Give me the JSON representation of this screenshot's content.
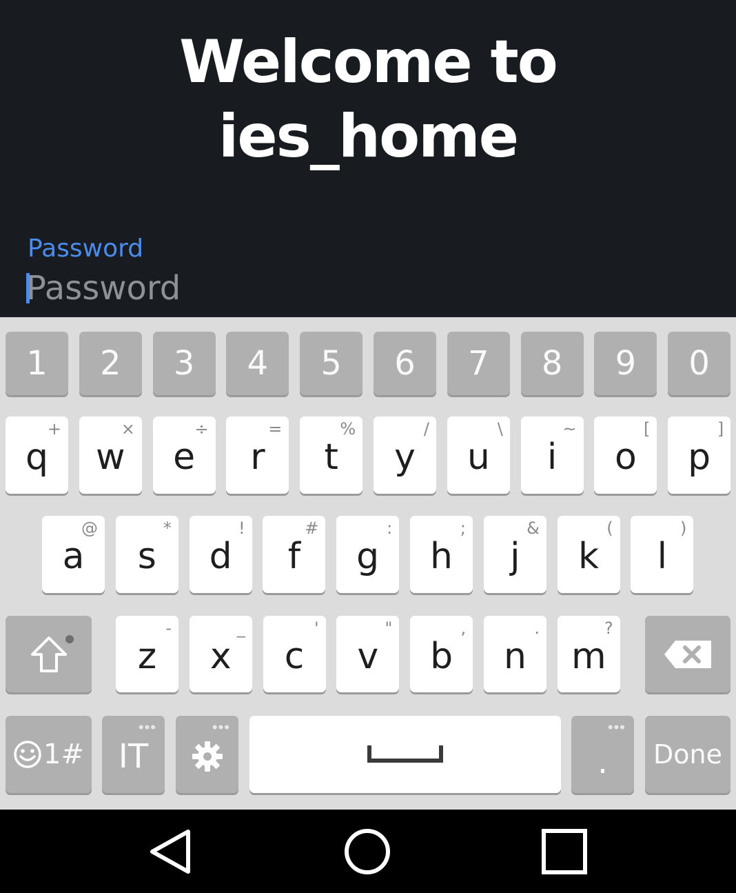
{
  "login": {
    "title_line1": "Welcome to",
    "title_line2": "ies_home",
    "password_label": "Password",
    "password_placeholder": "Password",
    "accent_color": "#4a8cf0"
  },
  "keyboard": {
    "numbers": [
      "1",
      "2",
      "3",
      "4",
      "5",
      "6",
      "7",
      "8",
      "9",
      "0"
    ],
    "row1": [
      {
        "key": "q",
        "alt": "+"
      },
      {
        "key": "w",
        "alt": "×"
      },
      {
        "key": "e",
        "alt": "÷"
      },
      {
        "key": "r",
        "alt": "="
      },
      {
        "key": "t",
        "alt": "%"
      },
      {
        "key": "y",
        "alt": "/"
      },
      {
        "key": "u",
        "alt": "\\"
      },
      {
        "key": "i",
        "alt": "~"
      },
      {
        "key": "o",
        "alt": "["
      },
      {
        "key": "p",
        "alt": "]"
      }
    ],
    "row2": [
      {
        "key": "a",
        "alt": "@"
      },
      {
        "key": "s",
        "alt": "*"
      },
      {
        "key": "d",
        "alt": "!"
      },
      {
        "key": "f",
        "alt": "#"
      },
      {
        "key": "g",
        "alt": ":"
      },
      {
        "key": "h",
        "alt": ";"
      },
      {
        "key": "j",
        "alt": "&"
      },
      {
        "key": "k",
        "alt": "("
      },
      {
        "key": "l",
        "alt": ")"
      }
    ],
    "row3": [
      {
        "key": "z",
        "alt": "-"
      },
      {
        "key": "x",
        "alt": "_"
      },
      {
        "key": "c",
        "alt": "'"
      },
      {
        "key": "v",
        "alt": "\""
      },
      {
        "key": "b",
        "alt": ","
      },
      {
        "key": "n",
        "alt": "."
      },
      {
        "key": "m",
        "alt": "?"
      }
    ],
    "symbols_label": "1#",
    "language_label": "IT",
    "period_label": ".",
    "done_label": "Done",
    "more_dots": "•••"
  }
}
